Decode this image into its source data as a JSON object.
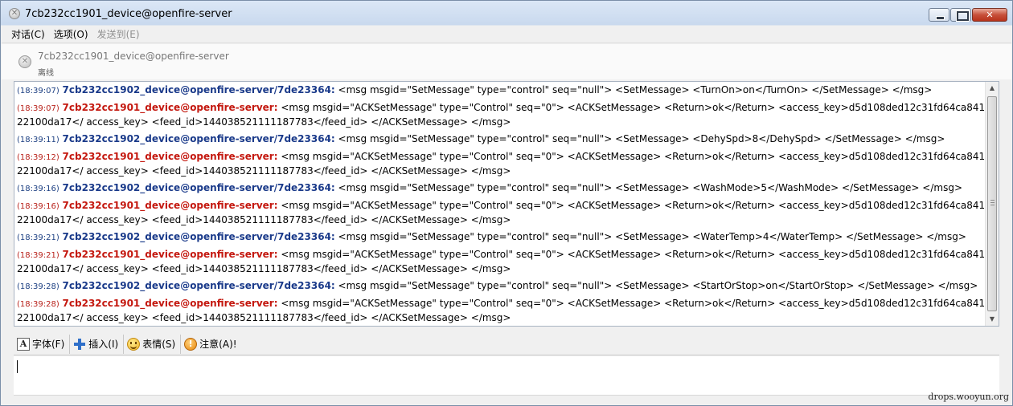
{
  "window": {
    "title": "7cb232cc1901_device@openfire-server"
  },
  "menu": {
    "items": [
      {
        "label": "对话(C)",
        "enabled": true
      },
      {
        "label": "选项(O)",
        "enabled": true
      },
      {
        "label": "发送到(E)",
        "enabled": false
      }
    ]
  },
  "contact": {
    "name": "7cb232cc1901_device@openfire-server",
    "status": "离线"
  },
  "transcript": {
    "messages": [
      {
        "dir": "sent",
        "time": "(18:39:07)",
        "sender": "7cb232cc1902_device@openfire-server/7de23364:",
        "text": " <msg msgid=\"SetMessage\" type=\"control\" seq=\"null\"> <SetMessage> <TurnOn>on</TurnOn> </SetMessage> </msg>"
      },
      {
        "dir": "recv",
        "time": "(18:39:07)",
        "sender": "7cb232cc1901_device@openfire-server:",
        "text": " <msg msgid=\"ACKSetMessage\" type=\"Control\" seq=\"0\"> <ACKSetMessage> <Return>ok</Return> <access_key>d5d108ded12c31fd64ca84122100da17</ access_key> <feed_id>144038521111187783</feed_id> </ACKSetMessage> </msg>"
      },
      {
        "dir": "sent",
        "time": "(18:39:11)",
        "sender": "7cb232cc1902_device@openfire-server/7de23364:",
        "text": " <msg msgid=\"SetMessage\" type=\"control\" seq=\"null\"> <SetMessage> <DehySpd>8</DehySpd> </SetMessage> </msg>"
      },
      {
        "dir": "recv",
        "time": "(18:39:12)",
        "sender": "7cb232cc1901_device@openfire-server:",
        "text": " <msg msgid=\"ACKSetMessage\" type=\"Control\" seq=\"0\"> <ACKSetMessage> <Return>ok</Return> <access_key>d5d108ded12c31fd64ca84122100da17</ access_key> <feed_id>144038521111187783</feed_id> </ACKSetMessage> </msg>"
      },
      {
        "dir": "sent",
        "time": "(18:39:16)",
        "sender": "7cb232cc1902_device@openfire-server/7de23364:",
        "text": " <msg msgid=\"SetMessage\" type=\"control\" seq=\"null\"> <SetMessage> <WashMode>5</WashMode> </SetMessage> </msg>"
      },
      {
        "dir": "recv",
        "time": "(18:39:16)",
        "sender": "7cb232cc1901_device@openfire-server:",
        "text": " <msg msgid=\"ACKSetMessage\" type=\"Control\" seq=\"0\"> <ACKSetMessage> <Return>ok</Return> <access_key>d5d108ded12c31fd64ca84122100da17</ access_key> <feed_id>144038521111187783</feed_id> </ACKSetMessage> </msg>"
      },
      {
        "dir": "sent",
        "time": "(18:39:21)",
        "sender": "7cb232cc1902_device@openfire-server/7de23364:",
        "text": " <msg msgid=\"SetMessage\" type=\"control\" seq=\"null\"> <SetMessage> <WaterTemp>4</WaterTemp> </SetMessage> </msg>"
      },
      {
        "dir": "recv",
        "time": "(18:39:21)",
        "sender": "7cb232cc1901_device@openfire-server:",
        "text": " <msg msgid=\"ACKSetMessage\" type=\"Control\" seq=\"0\"> <ACKSetMessage> <Return>ok</Return> <access_key>d5d108ded12c31fd64ca84122100da17</ access_key> <feed_id>144038521111187783</feed_id> </ACKSetMessage> </msg>"
      },
      {
        "dir": "sent",
        "time": "(18:39:28)",
        "sender": "7cb232cc1902_device@openfire-server/7de23364:",
        "text": " <msg msgid=\"SetMessage\" type=\"control\" seq=\"null\"> <SetMessage> <StartOrStop>on</StartOrStop> </SetMessage> </msg>"
      },
      {
        "dir": "recv",
        "time": "(18:39:28)",
        "sender": "7cb232cc1901_device@openfire-server:",
        "text": " <msg msgid=\"ACKSetMessage\" type=\"Control\" seq=\"0\"> <ACKSetMessage> <Return>ok</Return> <access_key>d5d108ded12c31fd64ca84122100da17</ access_key> <feed_id>144038521111187783</feed_id> </ACKSetMessage> </msg>"
      }
    ]
  },
  "toolbar": {
    "font_label": "字体(F)",
    "insert_label": "插入(I)",
    "emote_label": "表情(S)",
    "attention_label": "注意(A)!"
  },
  "input": {
    "value": ""
  },
  "watermark": "drops.wooyun.org",
  "colors": {
    "sent_sender": "#1a3a8a",
    "recv_sender": "#c4180f"
  }
}
